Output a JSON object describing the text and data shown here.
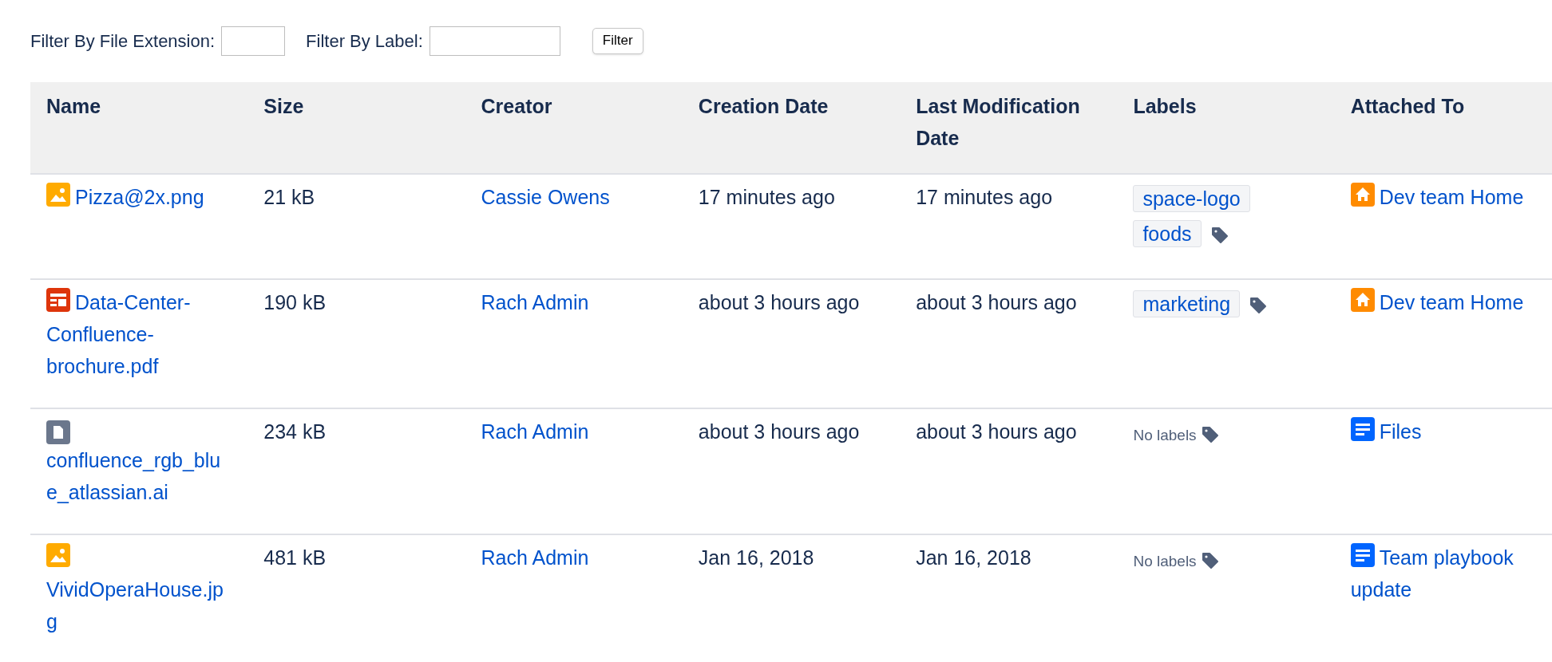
{
  "filters": [
    {
      "label": "Filter By File Extension:"
    },
    {
      "label": "Filter By Label:"
    }
  ],
  "filter_button": "Filter",
  "table": {
    "columns": [
      "Name",
      "Size",
      "Creator",
      "Creation Date",
      "Last Modification Date",
      "Labels",
      "Attached To"
    ],
    "rows": [
      {
        "file": {
          "name": "Pizza@2x.png",
          "kind": "image"
        },
        "size": "21 kB",
        "creator": "Cassie Owens",
        "created": "17 minutes ago",
        "modified": "17 minutes ago",
        "labels": [
          "space-logo",
          "foods"
        ],
        "attached": {
          "title": "Dev team Home",
          "kind": "space"
        }
      },
      {
        "file": {
          "name": "Data-Center-Confluence-brochure.pdf",
          "kind": "pdf"
        },
        "size": "190 kB",
        "creator": "Rach Admin",
        "created": "about 3 hours ago",
        "modified": "about 3 hours ago",
        "labels": [
          "marketing"
        ],
        "attached": {
          "title": "Dev team Home",
          "kind": "space"
        }
      },
      {
        "file": {
          "name": "confluence_rgb_blue_atlassian.ai",
          "kind": "generic"
        },
        "size": "234 kB",
        "creator": "Rach Admin",
        "created": "about 3 hours ago",
        "modified": "about 3 hours ago",
        "no_labels": "No labels",
        "attached": {
          "title": "Files",
          "kind": "page"
        }
      },
      {
        "file": {
          "name": "VividOperaHouse.jpg",
          "kind": "image"
        },
        "size": "481 kB",
        "creator": "Rach Admin",
        "created": "Jan 16, 2018",
        "modified": "Jan 16, 2018",
        "no_labels": "No labels",
        "attached": {
          "title": "Team playbook update",
          "kind": "page"
        }
      }
    ]
  }
}
